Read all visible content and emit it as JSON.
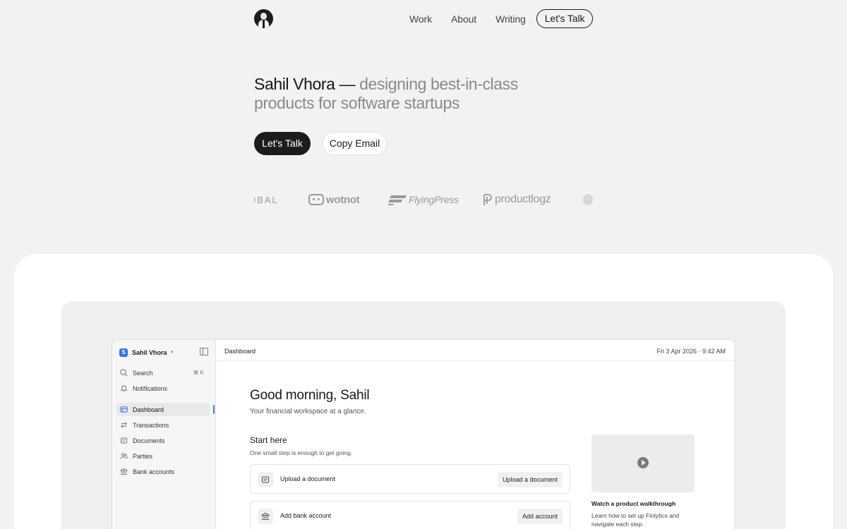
{
  "nav": {
    "links": [
      "Work",
      "About",
      "Writing"
    ],
    "cta": "Let's Talk"
  },
  "hero": {
    "name": "Sahil Vhora —",
    "tagline": "designing best-in-class products for software startups",
    "primary_button": "Let's Talk",
    "secondary_button": "Copy Email"
  },
  "logos": [
    "OBAL",
    "wotnot",
    "FlyingPress",
    "productlogz"
  ],
  "app": {
    "workspace": {
      "initial": "S",
      "name": "Sahil Vhora"
    },
    "sidebar": [
      {
        "label": "Search",
        "icon": "search-icon",
        "shortcut": "⌘ K"
      },
      {
        "label": "Notifications",
        "icon": "bell-icon"
      },
      {
        "label": "Dashboard",
        "icon": "dashboard-icon",
        "active": true
      },
      {
        "label": "Transactions",
        "icon": "transfer-icon"
      },
      {
        "label": "Documents",
        "icon": "document-icon"
      },
      {
        "label": "Parties",
        "icon": "users-icon"
      },
      {
        "label": "Bank accounts",
        "icon": "bank-icon"
      }
    ],
    "breadcrumb": "Dashboard",
    "datetime": "Fri 3 Apr 2026 · 9:42 AM",
    "greeting": "Good morning, Sahil",
    "subgreeting": "Your financial workspace at a glance.",
    "start": {
      "title": "Start here",
      "subtitle": "One small step is enough to get going.",
      "tasks": [
        {
          "label": "Upload a document",
          "button": "Upload a document",
          "icon": "document-icon"
        },
        {
          "label": "Add bank account",
          "button": "Add account",
          "icon": "bank-icon"
        }
      ]
    },
    "walkthrough": {
      "title": "Watch a product walkthrough",
      "description": "Learn how to set up Finlytics and navigate each step."
    }
  },
  "colors": {
    "accent": "#3c6fdc",
    "dark_button": "#1c1c1c",
    "page_bg": "#f2f2f2"
  }
}
